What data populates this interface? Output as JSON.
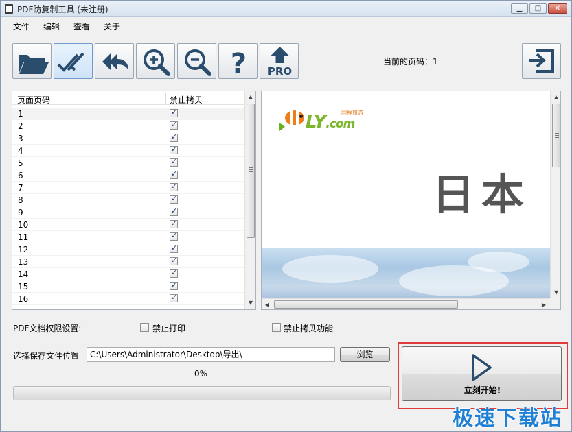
{
  "window": {
    "title": "PDF防复制工具 (未注册)",
    "min_label": "▁",
    "max_label": "□",
    "close_label": "✕"
  },
  "menu": [
    "文件",
    "编辑",
    "查看",
    "关于"
  ],
  "toolbar": {
    "buttons": [
      {
        "name": "open-folder-button",
        "icon": "folder-open-icon"
      },
      {
        "name": "select-all-button",
        "icon": "double-check-icon"
      },
      {
        "name": "undo-all-button",
        "icon": "double-arrow-left-icon"
      },
      {
        "name": "zoom-in-button",
        "icon": "zoom-in-icon"
      },
      {
        "name": "zoom-out-button",
        "icon": "zoom-out-icon"
      },
      {
        "name": "help-button",
        "icon": "question-icon"
      },
      {
        "name": "pro-upgrade-button",
        "icon": "up-arrow-icon",
        "label": "PRO"
      }
    ],
    "current_page_label": "当前的页码：1",
    "exit_icon": "exit-icon"
  },
  "page_list": {
    "col_page": "页面页码",
    "col_nocopy": "禁止拷贝",
    "rows": [
      "1",
      "2",
      "3",
      "4",
      "5",
      "6",
      "7",
      "8",
      "9",
      "10",
      "11",
      "12",
      "13",
      "14",
      "15",
      "16"
    ],
    "checked": true
  },
  "preview": {
    "logo_text": "LY",
    "logo_com": ".com",
    "logo_sub": "同程旅游",
    "headline": "日本"
  },
  "permissions": {
    "label": "PDF文档权限设置:",
    "no_print": "禁止打印",
    "no_copy": "禁止拷贝功能",
    "no_print_checked": false,
    "no_copy_checked": false
  },
  "save": {
    "label": "选择保存文件位置",
    "path": "C:\\Users\\Administrator\\Desktop\\导出\\",
    "browse": "浏览"
  },
  "progress": {
    "percent_text": "0%",
    "value": 0
  },
  "start": {
    "label": "立刻开始!",
    "icon": "play-icon"
  },
  "watermark": "极速下载站",
  "colors": {
    "accent_blue": "#2a4d6e",
    "highlight_red": "#e03a3a",
    "watermark_blue": "#1f80d4"
  }
}
